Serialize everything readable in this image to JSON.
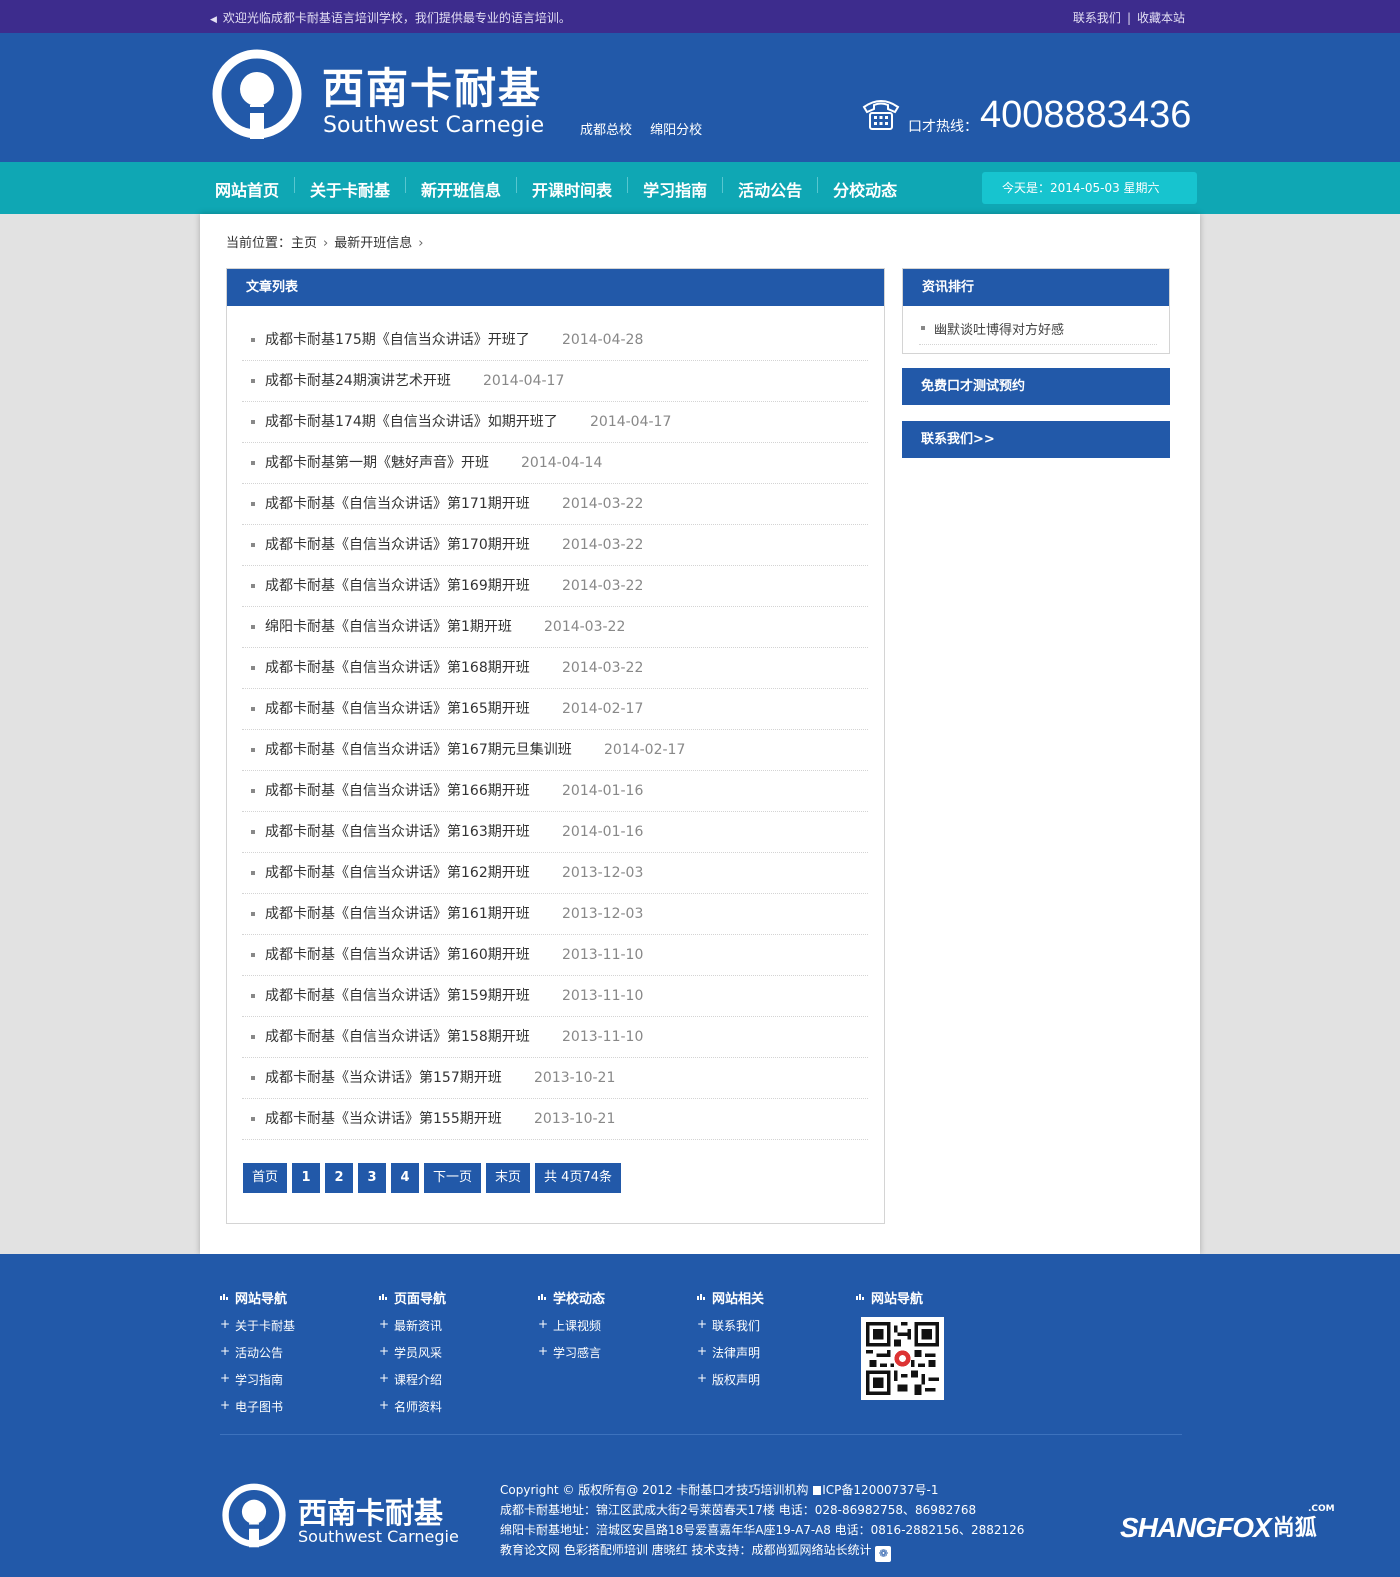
{
  "topbar": {
    "welcome": "欢迎光临成都卡耐基语言培训学校，我们提供最专业的语言培训。",
    "contact": "联系我们",
    "separator": "|",
    "bookmark": "收藏本站"
  },
  "header": {
    "brand_cn": "西南卡耐基",
    "brand_en": "Southwest Carnegie",
    "branches": [
      "成都总校",
      "绵阳分校"
    ],
    "hotline_label": "口才热线：",
    "hotline_number": "4008883436"
  },
  "nav": {
    "items": [
      "网站首页",
      "关于卡耐基",
      "新开班信息",
      "开课时间表",
      "学习指南",
      "活动公告",
      "分校动态"
    ],
    "date_text": "今天是：2014-05-03 星期六"
  },
  "breadcrumb": {
    "label": "当前位置：",
    "home": "主页",
    "current": "最新开班信息"
  },
  "article_list": {
    "title": "文章列表",
    "items": [
      {
        "title": "成都卡耐基175期《自信当众讲话》开班了",
        "date": "2014-04-28"
      },
      {
        "title": "成都卡耐基24期演讲艺术开班",
        "date": "2014-04-17"
      },
      {
        "title": "成都卡耐基174期《自信当众讲话》如期开班了",
        "date": "2014-04-17"
      },
      {
        "title": "成都卡耐基第一期《魅好声音》开班",
        "date": "2014-04-14"
      },
      {
        "title": "成都卡耐基《自信当众讲话》第171期开班",
        "date": "2014-03-22"
      },
      {
        "title": "成都卡耐基《自信当众讲话》第170期开班",
        "date": "2014-03-22"
      },
      {
        "title": "成都卡耐基《自信当众讲话》第169期开班",
        "date": "2014-03-22"
      },
      {
        "title": "绵阳卡耐基《自信当众讲话》第1期开班",
        "date": "2014-03-22"
      },
      {
        "title": "成都卡耐基《自信当众讲话》第168期开班",
        "date": "2014-03-22"
      },
      {
        "title": "成都卡耐基《自信当众讲话》第165期开班",
        "date": "2014-02-17"
      },
      {
        "title": "成都卡耐基《自信当众讲话》第167期元旦集训班",
        "date": "2014-02-17"
      },
      {
        "title": "成都卡耐基《自信当众讲话》第166期开班",
        "date": "2014-01-16"
      },
      {
        "title": "成都卡耐基《自信当众讲话》第163期开班",
        "date": "2014-01-16"
      },
      {
        "title": "成都卡耐基《自信当众讲话》第162期开班",
        "date": "2013-12-03"
      },
      {
        "title": "成都卡耐基《自信当众讲话》第161期开班",
        "date": "2013-12-03"
      },
      {
        "title": "成都卡耐基《自信当众讲话》第160期开班",
        "date": "2013-11-10"
      },
      {
        "title": "成都卡耐基《自信当众讲话》第159期开班",
        "date": "2013-11-10"
      },
      {
        "title": "成都卡耐基《自信当众讲话》第158期开班",
        "date": "2013-11-10"
      },
      {
        "title": "成都卡耐基《当众讲话》第157期开班",
        "date": "2013-10-21"
      },
      {
        "title": "成都卡耐基《当众讲话》第155期开班",
        "date": "2013-10-21"
      }
    ]
  },
  "pagination": {
    "first": "首页",
    "pages": [
      "1",
      "2",
      "3",
      "4"
    ],
    "next": "下一页",
    "last": "末页",
    "total": "共 4页74条"
  },
  "sidebar": {
    "rank_title": "资讯排行",
    "rank_items": [
      "幽默谈吐博得对方好感"
    ],
    "free_test": "免费口才测试预约",
    "contact_us": "联系我们>>"
  },
  "footer": {
    "columns": [
      {
        "title": "网站导航",
        "links": [
          "关于卡耐基",
          "活动公告",
          "学习指南",
          "电子图书"
        ]
      },
      {
        "title": "页面导航",
        "links": [
          "最新资讯",
          "学员风采",
          "课程介绍",
          "名师资料"
        ]
      },
      {
        "title": "学校动态",
        "links": [
          "上课视频",
          "学习感言"
        ]
      },
      {
        "title": "网站相关",
        "links": [
          "联系我们",
          "法律声明",
          "版权声明"
        ]
      },
      {
        "title": "网站导航",
        "links": []
      }
    ],
    "brand_cn": "西南卡耐基",
    "brand_en": "Southwest Carnegie",
    "copyright": "Copyright © 版权所有@ 2012 卡耐基口才技巧培训机构",
    "icp": "ICP备12000737号-1",
    "chengdu_address": "成都卡耐基地址：锦江区武成大街2号莱茵春天17楼 电话：028-86982758、86982768",
    "mianyang_address": "绵阳卡耐基地址：涪城区安昌路18号爱喜嘉年华A座19-A7-A8 电话：0816-2882156、2882126",
    "links_line": "教育论文网 色彩搭配师培训 唐晓红 技术支持：成都尚狐网络站长统计",
    "shangfox": "SHANGFOX",
    "shangfox_com": ".COM",
    "shangfox_cn": "尚狐",
    "paw_glyph": "❁"
  },
  "colors": {
    "topbar": "#3d2c8d",
    "header": "#2259a9",
    "nav": "#0fa7b4",
    "date_box": "#17c4cf",
    "panel_head": "#2259a9"
  }
}
